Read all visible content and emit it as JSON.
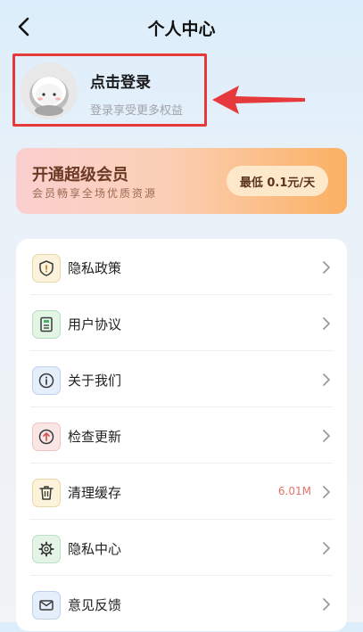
{
  "header": {
    "title": "个人中心"
  },
  "profile": {
    "login_title": "点击登录",
    "login_subtitle": "登录享受更多权益"
  },
  "vip": {
    "title": "开通超级会员",
    "subtitle": "会员畅享全场优质资源",
    "price_label": "最低 0.1元/天"
  },
  "menu": {
    "items": [
      {
        "label": "隐私政策",
        "icon": "shield-icon",
        "value": ""
      },
      {
        "label": "用户协议",
        "icon": "document-icon",
        "value": ""
      },
      {
        "label": "关于我们",
        "icon": "info-icon",
        "value": ""
      },
      {
        "label": "检查更新",
        "icon": "upload-icon",
        "value": ""
      },
      {
        "label": "清理缓存",
        "icon": "trash-icon",
        "value": "6.01M"
      },
      {
        "label": "隐私中心",
        "icon": "gear-icon",
        "value": ""
      },
      {
        "label": "意见反馈",
        "icon": "mail-icon",
        "value": ""
      }
    ]
  },
  "colors": {
    "highlight": "#e5393b",
    "vip_accent": "#fbb063",
    "cache_value": "#e2746a"
  }
}
